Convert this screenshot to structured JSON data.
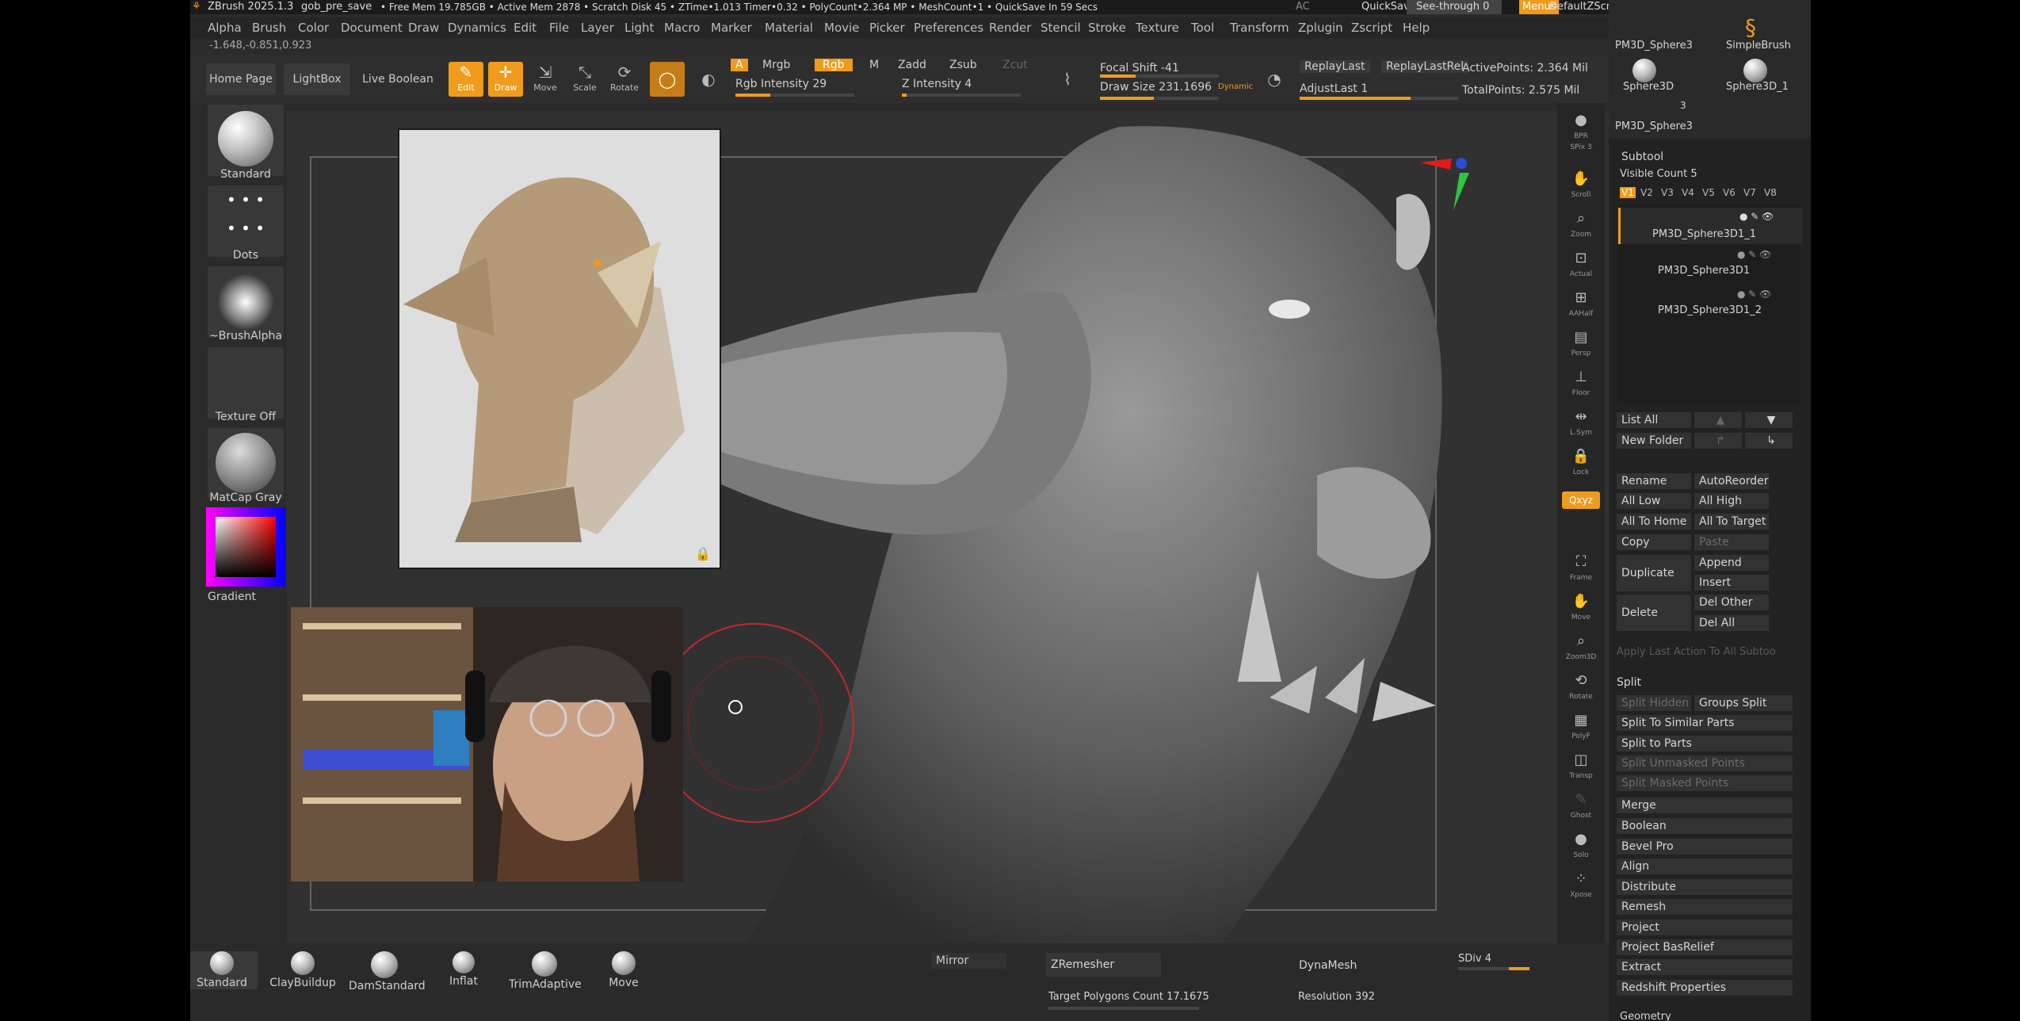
{
  "titlebar": {
    "app": "ZBrush 2025.1.3",
    "file": "gob_pre_save",
    "stats": "• Free Mem 19.785GB • Active Mem 2878 • Scratch Disk 45 •  ZTime•1.013 Timer•0.32 • PolyCount•2.364 MP  • MeshCount•1  • QuickSave In 59 Secs",
    "ac": "AC",
    "quicksave": "QuickSave",
    "see_through": "See-through  0",
    "menus": "Menus",
    "script": "DefaultZScript"
  },
  "menu": [
    "Alpha",
    "Brush",
    "Color",
    "Document",
    "Draw",
    "Dynamics",
    "Edit",
    "File",
    "Layer",
    "Light",
    "Macro",
    "Marker",
    "Material",
    "Movie",
    "Picker",
    "Preferences",
    "Render",
    "Stencil",
    "Stroke",
    "Texture",
    "Tool",
    "Transform",
    "Zplugin",
    "Zscript",
    "Help"
  ],
  "coords": "-1.648,-0.851,0.923",
  "toolbar": {
    "home": "Home Page",
    "lightbox": "LightBox",
    "live_boolean": "Live Boolean",
    "edit": "Edit",
    "draw": "Draw",
    "move": "Move",
    "scale": "Scale",
    "rotate": "Rotate",
    "a": "A",
    "mrgb": "Mrgb",
    "rgb": "Rgb",
    "m": "M",
    "zadd": "Zadd",
    "zsub": "Zsub",
    "zcut": "Zcut",
    "rgb_intensity": "Rgb Intensity 29",
    "z_intensity": "Z Intensity 4",
    "focal_shift": "Focal Shift -41",
    "draw_size": "Draw Size 231.1696",
    "dynamic": "Dynamic",
    "replay_last": "ReplayLast",
    "replay_last_rel": "ReplayLastRel",
    "adjust_last": "AdjustLast 1",
    "active_points": "ActivePoints: 2.364 Mil",
    "total_points": "TotalPoints: 2.575 Mil"
  },
  "toolbar_values": {
    "rgb_intensity": 0.29,
    "z_intensity": 0.04,
    "focal_shift": 0.3,
    "draw_size": 0.45,
    "adjust_last": 0.7
  },
  "left_shelf": {
    "brush": "Standard",
    "stroke": "Dots",
    "alpha": "~BrushAlpha",
    "texture": "Texture Off",
    "material": "MatCap Gray",
    "gradient": "Gradient"
  },
  "right_shelf": [
    "BPR",
    "SPix 3",
    "Scroll",
    "Zoom",
    "Actual",
    "AAHalf",
    "Persp",
    "Floor",
    "L.Sym",
    "Lock",
    "Qxyz",
    "Frame",
    "Move",
    "Zoom3D",
    "Rotate",
    "PolyF",
    "Transp",
    "Ghost",
    "Solo",
    "Xpose"
  ],
  "palette": {
    "tools": [
      "PM3D_Sphere3",
      "SimpleBrush",
      "Sphere3D",
      "Sphere3D_1",
      "PM3D_Sphere3"
    ],
    "tool_count": "3",
    "subtool_title": "Subtool",
    "visible_count": "Visible Count 5",
    "versions": [
      "V1",
      "V2",
      "V3",
      "V4",
      "V5",
      "V6",
      "V7",
      "V8"
    ],
    "subtools": [
      "PM3D_Sphere3D1_1",
      "PM3D_Sphere3D1",
      "PM3D_Sphere3D1_2"
    ],
    "list_all": "List All",
    "new_folder": "New Folder",
    "rename": "Rename",
    "auto_reorder": "AutoReorder",
    "all_low": "All Low",
    "all_high": "All High",
    "all_to_home": "All To Home",
    "all_to_target": "All To Target",
    "copy": "Copy",
    "paste": "Paste",
    "duplicate": "Duplicate",
    "append": "Append",
    "insert": "Insert",
    "delete": "Delete",
    "del_other": "Del Other",
    "del_all": "Del All",
    "apply_last": "Apply Last Action To All Subtoo",
    "split": "Split",
    "split_hidden": "Split Hidden",
    "groups_split": "Groups Split",
    "split_similar": "Split To Similar Parts",
    "split_parts": "Split to Parts",
    "split_unmasked": "Split Unmasked Points",
    "split_masked": "Split Masked Points",
    "merge": "Merge",
    "boolean": "Boolean",
    "bevel_pro": "Bevel Pro",
    "align": "Align",
    "distribute": "Distribute",
    "remesh": "Remesh",
    "project": "Project",
    "project_basrelief": "Project BasRelief",
    "extract": "Extract",
    "redshift": "Redshift Properties",
    "geometry": "Geometry"
  },
  "bottom": {
    "brushes": [
      "Standard",
      "ClayBuildup",
      "DamStandard",
      "Inflat",
      "TrimAdaptive",
      "Move"
    ],
    "mirror": "Mirror",
    "zremesher": "ZRemesher",
    "target_polygons": "Target Polygons Count  17.1675",
    "dynamesh": "DynaMesh",
    "resolution": "Resolution  392",
    "sdiv": "SDiv 4"
  },
  "colors": {
    "accent": "#f09b1c",
    "cursor_ring": "#c0282b"
  }
}
